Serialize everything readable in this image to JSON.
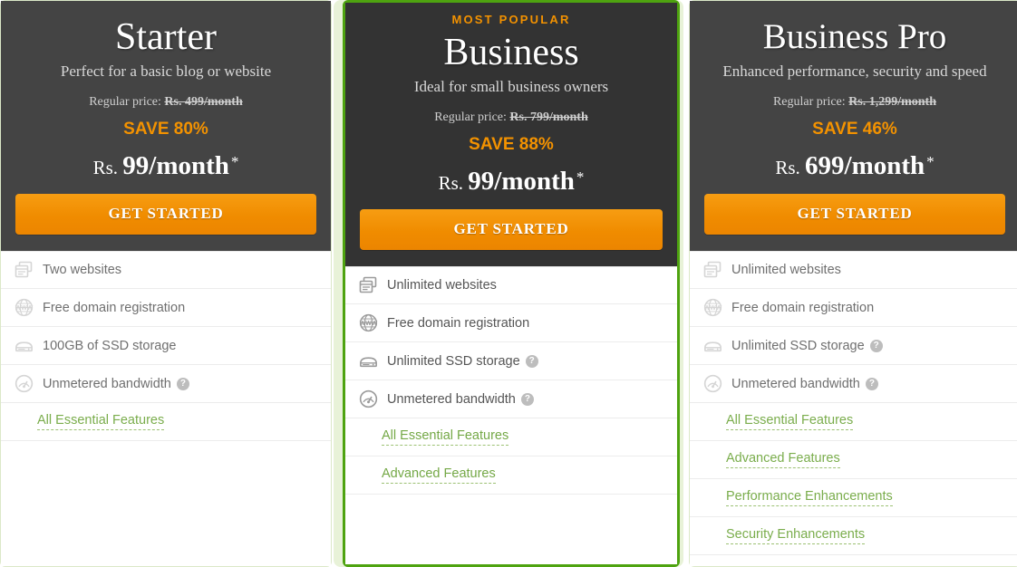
{
  "theme": {
    "accent_orange": "#f39200",
    "link_green": "#7aad4c",
    "featured_border_green": "#4ea310",
    "featured_halo_green": "#e8f2d8",
    "header_dark": "#444444",
    "header_dark_featured": "#333333"
  },
  "plans": [
    {
      "id": "starter",
      "badge": "",
      "name": "Starter",
      "tagline": "Perfect for a basic blog or website",
      "regular_price_label": "Regular price:",
      "regular_price_value": "Rs. 499/month",
      "save_text": "SAVE 80%",
      "price_currency": "Rs.",
      "price_amount": "99/month",
      "price_asterisk": "*",
      "cta_label": "GET STARTED",
      "features": [
        {
          "icon": "websites-icon",
          "label": "Two websites",
          "help": false
        },
        {
          "icon": "www-globe-icon",
          "label": "Free domain registration",
          "help": false
        },
        {
          "icon": "ssd-storage-icon",
          "label": "100GB of SSD storage",
          "help": false
        },
        {
          "icon": "bandwidth-gauge-icon",
          "label": "Unmetered bandwidth",
          "help": true
        }
      ],
      "links": [
        "All Essential Features"
      ]
    },
    {
      "id": "business",
      "badge": "MOST POPULAR",
      "name": "Business",
      "tagline": "Ideal for small business owners",
      "regular_price_label": "Regular price:",
      "regular_price_value": "Rs. 799/month",
      "save_text": "SAVE 88%",
      "price_currency": "Rs.",
      "price_amount": "99/month",
      "price_asterisk": "*",
      "cta_label": "GET STARTED",
      "features": [
        {
          "icon": "websites-icon",
          "label": "Unlimited websites",
          "help": false
        },
        {
          "icon": "www-globe-icon",
          "label": "Free domain registration",
          "help": false
        },
        {
          "icon": "ssd-storage-icon",
          "label": "Unlimited SSD storage",
          "help": true
        },
        {
          "icon": "bandwidth-gauge-icon",
          "label": "Unmetered bandwidth",
          "help": true
        }
      ],
      "links": [
        "All Essential Features",
        "Advanced Features"
      ]
    },
    {
      "id": "business-pro",
      "badge": "",
      "name": "Business Pro",
      "tagline": "Enhanced performance, security and speed",
      "regular_price_label": "Regular price:",
      "regular_price_value": "Rs. 1,299/month",
      "save_text": "SAVE 46%",
      "price_currency": "Rs.",
      "price_amount": "699/month",
      "price_asterisk": "*",
      "cta_label": "GET STARTED",
      "features": [
        {
          "icon": "websites-icon",
          "label": "Unlimited websites",
          "help": false
        },
        {
          "icon": "www-globe-icon",
          "label": "Free domain registration",
          "help": false
        },
        {
          "icon": "ssd-storage-icon",
          "label": "Unlimited SSD storage",
          "help": true
        },
        {
          "icon": "bandwidth-gauge-icon",
          "label": "Unmetered bandwidth",
          "help": true
        }
      ],
      "links": [
        "All Essential Features",
        "Advanced Features",
        "Performance Enhancements",
        "Security Enhancements"
      ]
    }
  ],
  "help_icon_glyph": "?"
}
